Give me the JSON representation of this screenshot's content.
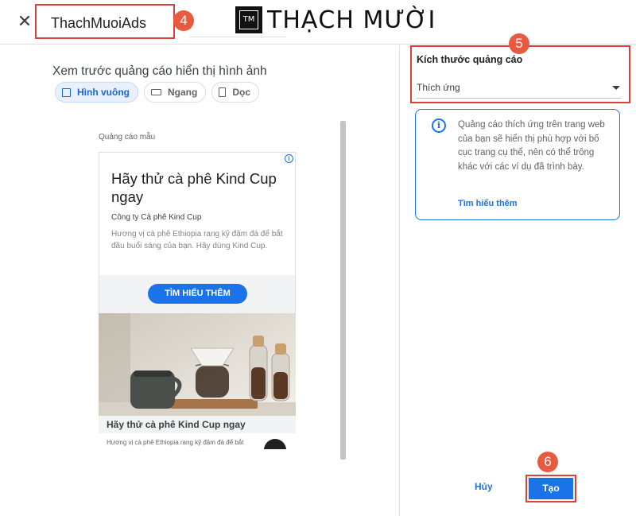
{
  "header": {
    "close_glyph": "✕",
    "ad_name": "ThachMuoiAds",
    "logo_mark": "TM",
    "logo_text": "THẠCH MƯỜI"
  },
  "steps": {
    "name": "4",
    "size": "5",
    "create": "6"
  },
  "preview": {
    "title": "Xem trước quảng cáo hiển thị hình ảnh",
    "chips": [
      {
        "label": "Hình vuông",
        "active": true
      },
      {
        "label": "Ngang",
        "active": false
      },
      {
        "label": "Dọc",
        "active": false
      }
    ],
    "sample_label": "Quảng cáo mẫu",
    "ad1": {
      "info_glyph": "i",
      "headline": "Hãy thử cà phê Kind Cup ngay",
      "company": "Công ty Cà phê Kind Cup",
      "description": "Hương vị cà phê Ethiopia rang kỹ đậm đà để bắt đầu buổi sáng của bạn. Hãy dùng Kind Cup.",
      "cta": "TÌM HIỂU THÊM"
    },
    "ad2": {
      "headline": "Hãy thử cà phê Kind Cup ngay",
      "description": "Hương vị cà phê Ethiopia rang kỹ đậm đà để bắt"
    }
  },
  "settings": {
    "size_title": "Kích thước quảng cáo",
    "size_value": "Thích ứng",
    "info_glyph": "i",
    "info_text": "Quảng cáo thích ứng trên trang web của bạn sẽ hiển thị phù hợp với bố cục trang cụ thể, nên có thể trông khác với các ví dụ đã trình bày.",
    "learn_more": "Tìm hiểu thêm"
  },
  "actions": {
    "cancel": "Hủy",
    "create": "Tạo"
  },
  "colors": {
    "accent": "#1a73e8",
    "highlight": "#d9413a",
    "badge": "#e85a3f"
  }
}
